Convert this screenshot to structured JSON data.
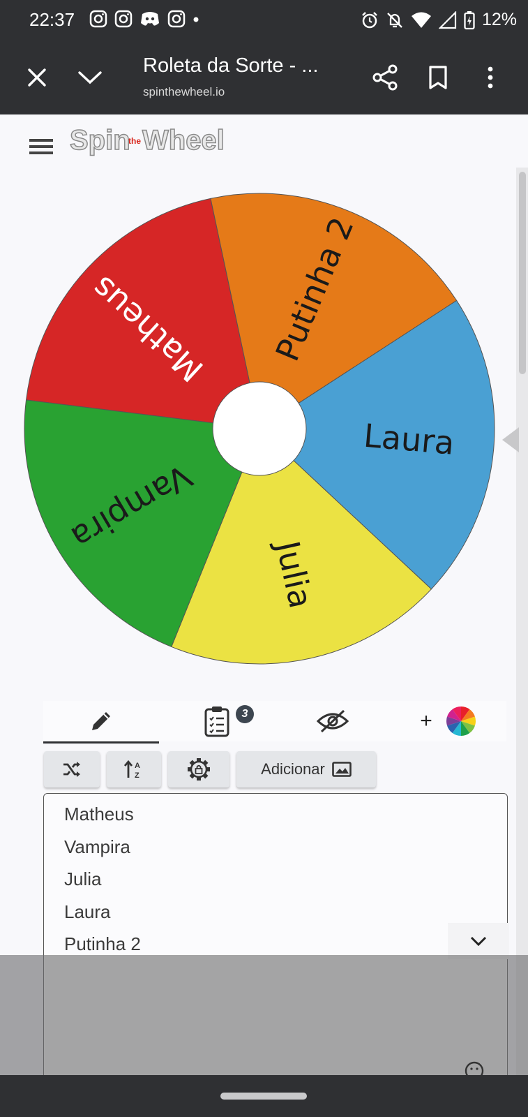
{
  "status_bar": {
    "time": "22:37",
    "battery": "12%",
    "left_icons": [
      "instagram-icon",
      "instagram-icon",
      "discord-icon",
      "instagram-icon",
      "dot-icon"
    ],
    "right_icons": [
      "alarm-icon",
      "bell-off-icon",
      "wifi-icon",
      "signal-icon",
      "battery-icon"
    ]
  },
  "app_bar": {
    "title": "Roleta da Sorte - ...",
    "url": "spinthewheel.io"
  },
  "logo": {
    "spin": "Spin",
    "the": "the",
    "wheel": "Wheel"
  },
  "wheel": {
    "segments": [
      {
        "label": "Matheus",
        "color": "#d62626",
        "text_color": "#ffffff"
      },
      {
        "label": "Putinha 2",
        "color": "#e57a18",
        "text_color": "#1a1a1a"
      },
      {
        "label": "Laura",
        "color": "#4aa0d3",
        "text_color": "#1a1a1a"
      },
      {
        "label": "Julia",
        "color": "#ebe243",
        "text_color": "#1a1a1a"
      },
      {
        "label": "Vampira",
        "color": "#29a232",
        "text_color": "#1a1a1a"
      }
    ]
  },
  "tabs": {
    "results_badge": "3",
    "add_label": "+"
  },
  "toolbar": {
    "add_button_label": "Adicionar"
  },
  "entries": [
    "Matheus",
    "Vampira",
    "Julia",
    "Laura",
    "Putinha 2"
  ],
  "colors": {
    "bar": "#2f3033",
    "page": "#f8f8fb",
    "button": "#e4e6e9"
  }
}
